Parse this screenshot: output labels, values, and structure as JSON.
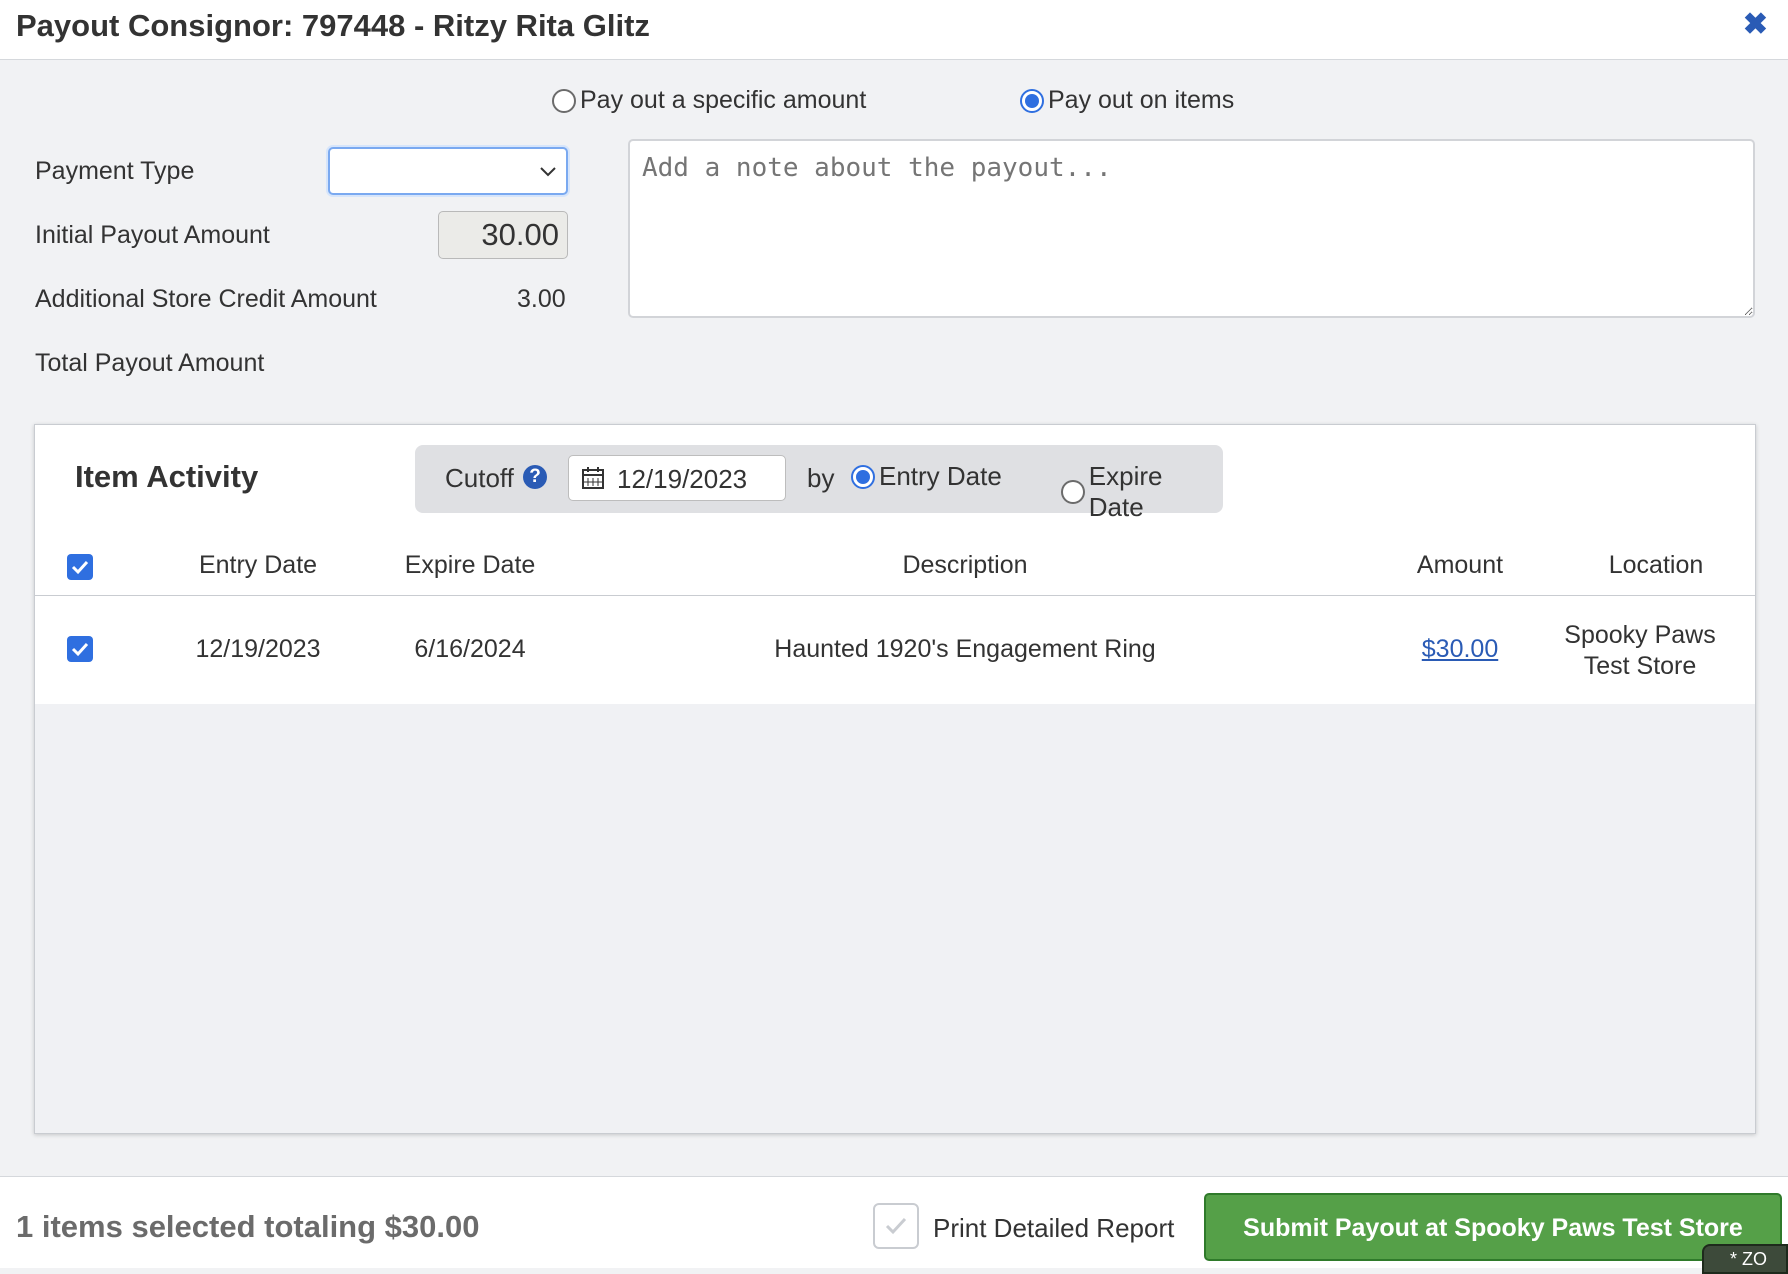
{
  "title": "Payout Consignor: 797448 - Ritzy Rita Glitz",
  "payout_mode": {
    "specific_amount_label": "Pay out a specific amount",
    "on_items_label": "Pay out on items",
    "selected": "on_items"
  },
  "form": {
    "payment_type_label": "Payment Type",
    "payment_type_value": "",
    "initial_payout_label": "Initial Payout Amount",
    "initial_payout_value": "30.00",
    "store_credit_label": "Additional Store Credit Amount",
    "store_credit_value": "3.00",
    "total_payout_label": "Total Payout Amount",
    "note_placeholder": "Add a note about the payout..."
  },
  "item_activity": {
    "title": "Item Activity",
    "cutoff_label": "Cutoff",
    "cutoff_date": "12/19/2023",
    "by_label": "by",
    "entry_date_option": "Entry Date",
    "expire_date_option": "Expire Date",
    "cutoff_by_selected": "entry_date",
    "columns": [
      "Entry Date",
      "Expire Date",
      "Description",
      "Amount",
      "Location"
    ],
    "rows": [
      {
        "checked": true,
        "entry_date": "12/19/2023",
        "expire_date": "6/16/2024",
        "description": "Haunted 1920's Engagement Ring",
        "amount": "$30.00",
        "location_line1": "Spooky Paws",
        "location_line2": "Test Store"
      }
    ]
  },
  "footer": {
    "summary": "1 items selected totaling $30.00",
    "print_label": "Print Detailed Report",
    "submit_label": "Submit Payout at Spooky Paws Test Store",
    "corner_tab_text": "* ZO"
  },
  "colors": {
    "accent_blue": "#2f6fe0",
    "link_blue": "#2a5bb5",
    "submit_green": "#55a048"
  }
}
